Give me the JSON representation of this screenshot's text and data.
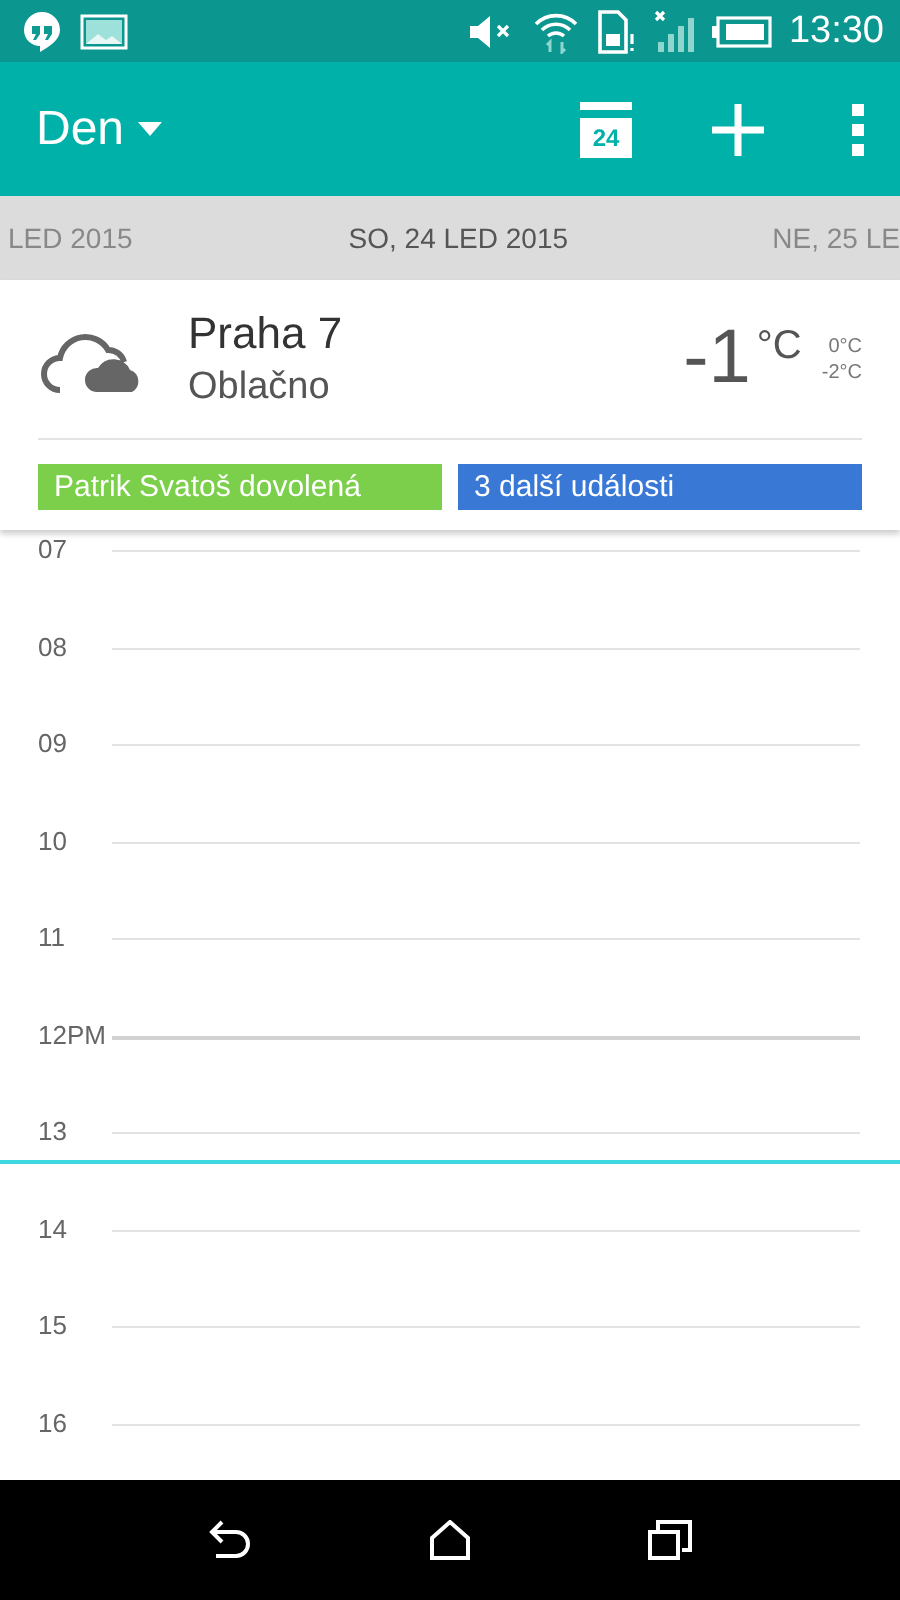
{
  "status_bar": {
    "time": "13:30"
  },
  "app_bar": {
    "view": "Den",
    "today_badge": "24"
  },
  "date_strip": [
    {
      "label": "LED 2015",
      "selected": false
    },
    {
      "label": "SO, 24 LED 2015",
      "selected": true
    },
    {
      "label": "NE, 25 LE",
      "selected": false
    }
  ],
  "weather": {
    "location": "Praha 7",
    "condition": "Oblačno",
    "temperature": "-1",
    "unit": "°C",
    "high": "0°C",
    "low": "-2°C"
  },
  "all_day_events": [
    {
      "title": "Patrik Svatoš dovolená",
      "color": "#7ccf4a"
    },
    {
      "title": "3 další události",
      "color": "#3a78d6"
    }
  ],
  "hours": [
    {
      "label": "07",
      "current": false
    },
    {
      "label": "08",
      "current": false
    },
    {
      "label": "09",
      "current": false
    },
    {
      "label": "10",
      "current": false
    },
    {
      "label": "11",
      "current": false
    },
    {
      "label": "12PM",
      "current": false,
      "kind": "noon"
    },
    {
      "label": "13",
      "current": true
    },
    {
      "label": "14",
      "current": false
    },
    {
      "label": "15",
      "current": false
    },
    {
      "label": "16",
      "current": false
    }
  ]
}
